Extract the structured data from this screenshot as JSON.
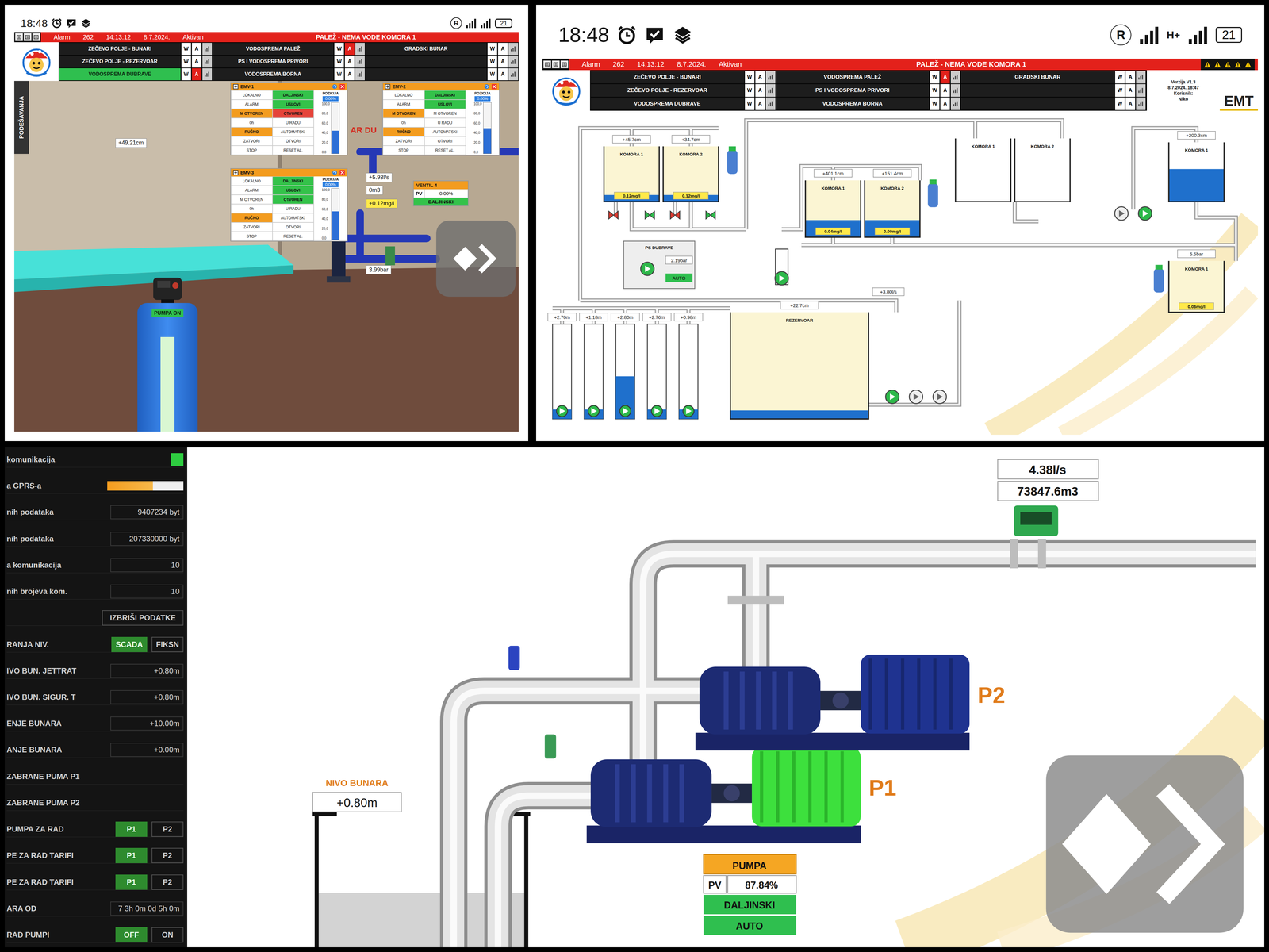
{
  "left_screen": {
    "status_bar": {
      "time": "18:48",
      "registered": "R",
      "network": "",
      "battery": "21"
    },
    "header": {
      "alarm": {
        "label": "Alarm",
        "code": "262",
        "time": "14:13:12",
        "date": "8.7.2024.",
        "state": "Aktivan",
        "message": "PALEŽ - NEMA VODE KOMORA 1"
      },
      "nav_buttons": [
        "W",
        "A"
      ],
      "nav": [
        {
          "label": "ZEČEVO POLJE - BUNARI",
          "selected": false,
          "alarm": false
        },
        {
          "label": "ZEČEVO POLJE - REZERVOAR",
          "selected": false,
          "alarm": false
        },
        {
          "label": "VODOSPREMA DUBRAVE",
          "selected": true,
          "alarm": true
        },
        {
          "label": "VODOSPREMA PALEŽ",
          "selected": false,
          "alarm": true
        },
        {
          "label": "PS I VODOSPREMA PRIVORI",
          "selected": false,
          "alarm": false
        },
        {
          "label": "VODOSPREMA BORNA",
          "selected": false,
          "alarm": false
        },
        {
          "label": "GRADSKI BUNAR",
          "selected": false,
          "alarm": false
        },
        {
          "label": "",
          "selected": false,
          "alarm": false
        },
        {
          "label": "",
          "selected": false,
          "alarm": false
        }
      ],
      "info": null
    },
    "scene": {
      "side_tab": "PODEŠAVANJA",
      "room_label": "AR DU",
      "readings": [
        {
          "text": "+49.21cm",
          "kind": "plain"
        },
        {
          "text": "+5.93l/s",
          "kind": "plain"
        },
        {
          "text": "0m3",
          "kind": "plain"
        },
        {
          "text": "+0.12mg/l",
          "kind": "chlorine"
        },
        {
          "text": "3.99bar",
          "kind": "plain"
        }
      ],
      "valves": [
        {
          "title": "EMV-1",
          "rows": [
            [
              {
                "text": "LOKALNO",
                "on": false
              },
              {
                "text": "DALJINSKI",
                "on": true,
                "color": "#34c24a"
              }
            ],
            [
              {
                "text": "ALARM",
                "on": false
              },
              {
                "text": "USLOVI",
                "on": true,
                "color": "#34c24a"
              }
            ],
            [
              {
                "text": "M OTVOREN",
                "on": true,
                "color": "#f39c1f"
              },
              {
                "text": "OTVOREN",
                "on": true,
                "color": "#e5443a"
              }
            ],
            [
              {
                "text": "0h",
                "on": false
              },
              {
                "text": "U RADU",
                "on": false
              }
            ],
            [
              {
                "text": "RUČNO",
                "on": true,
                "color": "#f39c1f"
              },
              {
                "text": "AUTOMATSKI",
                "on": false
              }
            ],
            [
              {
                "text": "ZATVORI",
                "on": false
              },
              {
                "text": "OTVORI",
                "on": false
              }
            ],
            [
              {
                "text": "STOP",
                "on": false
              },
              {
                "text": "RESET AL.",
                "on": false
              }
            ]
          ],
          "position": {
            "title": "POZICIJA",
            "value": "0.00%",
            "level": 0.45,
            "ticks": [
              "100,0",
              "80,0",
              "60,0",
              "40,0",
              "20,0",
              "0,0"
            ]
          }
        },
        {
          "title": "EMV-2",
          "rows": [
            [
              {
                "text": "LOKALNO",
                "on": false
              },
              {
                "text": "DALJINSKI",
                "on": true,
                "color": "#34c24a"
              }
            ],
            [
              {
                "text": "ALARM",
                "on": false
              },
              {
                "text": "USLOVI",
                "on": true,
                "color": "#34c24a"
              }
            ],
            [
              {
                "text": "M OTVOREN",
                "on": true,
                "color": "#f39c1f"
              },
              {
                "text": "M OTVOREN",
                "on": false
              }
            ],
            [
              {
                "text": "0h",
                "on": false
              },
              {
                "text": "U RADU",
                "on": false
              }
            ],
            [
              {
                "text": "RUČNO",
                "on": true,
                "color": "#f39c1f"
              },
              {
                "text": "AUTOMATSKI",
                "on": false
              }
            ],
            [
              {
                "text": "ZATVORI",
                "on": false
              },
              {
                "text": "OTVORI",
                "on": false
              }
            ],
            [
              {
                "text": "STOP",
                "on": false
              },
              {
                "text": "RESET AL.",
                "on": false
              }
            ]
          ],
          "position": {
            "title": "POZICIJA",
            "value": "0.00%",
            "level": 0.5,
            "ticks": [
              "100,0",
              "80,0",
              "60,0",
              "40,0",
              "20,0",
              "0,0"
            ]
          }
        },
        {
          "title": "EMV-3",
          "rows": [
            [
              {
                "text": "LOKALNO",
                "on": false
              },
              {
                "text": "DALJINSKI",
                "on": true,
                "color": "#34c24a"
              }
            ],
            [
              {
                "text": "ALARM",
                "on": false
              },
              {
                "text": "USLOVI",
                "on": true,
                "color": "#34c24a"
              }
            ],
            [
              {
                "text": "M OTVOREN",
                "on": false
              },
              {
                "text": "OTVOREN",
                "on": true,
                "color": "#34c24a"
              }
            ],
            [
              {
                "text": "0h",
                "on": false
              },
              {
                "text": "U RADU",
                "on": false
              }
            ],
            [
              {
                "text": "RUČNO",
                "on": true,
                "color": "#f39c1f"
              },
              {
                "text": "AUTOMATSKI",
                "on": false
              }
            ],
            [
              {
                "text": "ZATVORI",
                "on": false
              },
              {
                "text": "OTVORI",
                "on": false
              }
            ],
            [
              {
                "text": "STOP",
                "on": false
              },
              {
                "text": "RESET AL.",
                "on": false
              }
            ]
          ],
          "position": {
            "title": "POZICIJA",
            "value": "0.00%",
            "level": 0.55,
            "ticks": [
              "100,0",
              "80,0",
              "60,0",
              "40,0",
              "20,0",
              "0,0"
            ]
          }
        }
      ],
      "ventil": {
        "title": "VENTIL 4",
        "pv_label": "PV",
        "pv": "0.00%",
        "mode": "DALJINSKI"
      },
      "dosing_pump": {
        "label": "PUMPA ON",
        "on": true,
        "level": 0.85
      }
    }
  },
  "right_screen": {
    "status_bar": {
      "time": "18:48",
      "registered": "R",
      "network": "H+",
      "battery": "21"
    },
    "header": {
      "alarm": {
        "label": "Alarm",
        "code": "262",
        "time": "14:13:12",
        "date": "8.7.2024.",
        "state": "Aktivan",
        "message": "PALEŽ - NEMA VODE KOMORA 1"
      },
      "nav_buttons": [
        "W",
        "A"
      ],
      "nav": [
        {
          "label": "ZEČEVO POLJE - BUNARI",
          "selected": false,
          "alarm": false
        },
        {
          "label": "ZEČEVO POLJE - REZERVOAR",
          "selected": false,
          "alarm": false
        },
        {
          "label": "VODOSPREMA DUBRAVE",
          "selected": false,
          "alarm": false
        },
        {
          "label": "VODOSPREMA PALEŽ",
          "selected": false,
          "alarm": true
        },
        {
          "label": "PS I VODOSPREMA PRIVORI",
          "selected": false,
          "alarm": false
        },
        {
          "label": "VODOSPREMA BORNA",
          "selected": false,
          "alarm": false
        },
        {
          "label": "GRADSKI BUNAR",
          "selected": false,
          "alarm": false
        },
        {
          "label": "",
          "selected": false,
          "alarm": false
        },
        {
          "label": "",
          "selected": false,
          "alarm": false
        }
      ],
      "info": {
        "lines": [
          "Verzija V1.3",
          "8.7.2024. 18:47",
          "Korisnik:",
          "Niko"
        ],
        "brand": "EMT"
      }
    },
    "diagram": {
      "tanks": [
        {
          "label": "KOMORA 1",
          "in_service": true,
          "level": 0.12,
          "reading": "+45.7cm",
          "chlorine": "0.12mg/l"
        },
        {
          "label": "KOMORA 2",
          "in_service": true,
          "level": 0.12,
          "reading": "+34.7cm",
          "chlorine": "0.12mg/l"
        },
        {
          "label": "KOMORA 1",
          "in_service": true,
          "level": 0.3,
          "reading": "+401.1cm",
          "chlorine": "0.04mg/l"
        },
        {
          "label": "KOMORA 2",
          "in_service": true,
          "level": 0.3,
          "reading": "+151.4cm",
          "chlorine": "0.00mg/l"
        },
        {
          "label": "KOMORA 1",
          "in_service": false,
          "level": 0,
          "reading": "",
          "chlorine": ""
        },
        {
          "label": "KOMORA 2",
          "in_service": false,
          "level": 0,
          "reading": "",
          "chlorine": ""
        },
        {
          "label": "KOMORA 1",
          "in_service": false,
          "level": 0.55,
          "reading": "+200.3cm",
          "chlorine": ""
        },
        {
          "label": "KOMORA 1",
          "in_service": true,
          "level": 0,
          "reading": "5.5bar",
          "chlorine": "0.06mg/l"
        },
        {
          "label": "REZERVOAR",
          "in_service": true,
          "level": 0.08,
          "reading": "+22.7cm",
          "chlorine": ""
        }
      ],
      "wells": [
        {
          "reading": "+2.70m",
          "level": 0.1,
          "running": true
        },
        {
          "reading": "+1.18m",
          "level": 0.1,
          "running": true
        },
        {
          "reading": "+2.80m",
          "level": 0.45,
          "running": true
        },
        {
          "reading": "+2.76m",
          "level": 0.1,
          "running": true
        },
        {
          "reading": "+0.98m",
          "level": 0.1,
          "running": true
        }
      ],
      "pumps": [
        {
          "running": true
        },
        {
          "running": true
        },
        {
          "running": false
        },
        {
          "running": true
        },
        {
          "running": true
        },
        {
          "running": false
        },
        {
          "running": false
        }
      ],
      "valves": [
        {
          "open": false
        },
        {
          "open": true
        },
        {
          "open": false
        },
        {
          "open": true
        }
      ],
      "station": {
        "label": "PS DUBRAVE",
        "reading": "2.19bar",
        "mode": "AUTO"
      },
      "flow": "+3.80l/s"
    }
  },
  "bottom_screen": {
    "sidebar": [
      {
        "kind": "indicator",
        "label": "komunikacija",
        "on": true
      },
      {
        "kind": "bar",
        "label": "a GPRS-a",
        "level": 0.6
      },
      {
        "kind": "value",
        "label": "nih podataka",
        "value": "9407234 byt"
      },
      {
        "kind": "value",
        "label": "nih podataka",
        "value": "207330000 byt"
      },
      {
        "kind": "value",
        "label": "a komunikacija",
        "value": "10"
      },
      {
        "kind": "value",
        "label": "nih brojeva kom.",
        "value": "10"
      },
      {
        "kind": "button",
        "label": "IZBRIŠI PODATKE"
      },
      {
        "kind": "toggle",
        "label": "RANJA NIV.",
        "options": [
          {
            "text": "SCADA",
            "selected": true
          },
          {
            "text": "FIKSN",
            "selected": false
          }
        ]
      },
      {
        "kind": "value",
        "label": "IVO BUN. JETTRAT",
        "value": "+0.80m"
      },
      {
        "kind": "value",
        "label": "IVO BUN. SIGUR. T",
        "value": "+0.80m"
      },
      {
        "kind": "value",
        "label": "ENJE BUNARA",
        "value": "+10.00m"
      },
      {
        "kind": "value",
        "label": "ANJE BUNARA",
        "value": "+0.00m"
      },
      {
        "kind": "label",
        "label": "ZABRANE PUMA P1"
      },
      {
        "kind": "label",
        "label": "ZABRANE PUMA P2"
      },
      {
        "kind": "toggle",
        "label": "PUMPA ZA RAD",
        "options": [
          {
            "text": "P1",
            "selected": true
          },
          {
            "text": "P2",
            "selected": false
          }
        ]
      },
      {
        "kind": "toggle",
        "label": "PE ZA RAD TARIFI",
        "options": [
          {
            "text": "P1",
            "selected": true
          },
          {
            "text": "P2",
            "selected": false
          }
        ]
      },
      {
        "kind": "toggle",
        "label": "PE ZA RAD TARIFI",
        "options": [
          {
            "text": "P1",
            "selected": true
          },
          {
            "text": "P2",
            "selected": false
          }
        ]
      },
      {
        "kind": "value",
        "label": "ARA OD",
        "value": "7 3h 0m 0d 5h 0m"
      },
      {
        "kind": "toggle",
        "label": "RAD PUMPI",
        "options": [
          {
            "text": "OFF",
            "selected": true
          },
          {
            "text": "ON",
            "selected": false
          }
        ]
      }
    ],
    "main": {
      "flow": {
        "rate": "4.38l/s",
        "total": "73847.6m3"
      },
      "well": {
        "label": "NIVO BUNARA",
        "value": "+0.80m",
        "level": 0.45
      },
      "pumps": [
        {
          "label": "P1",
          "running": true
        },
        {
          "label": "P2",
          "running": false
        }
      ],
      "pump_panel": {
        "title": "PUMPA",
        "pv_label": "PV",
        "pv": "87.84%",
        "mode": "DALJINSKI",
        "auto": "AUTO"
      }
    }
  }
}
